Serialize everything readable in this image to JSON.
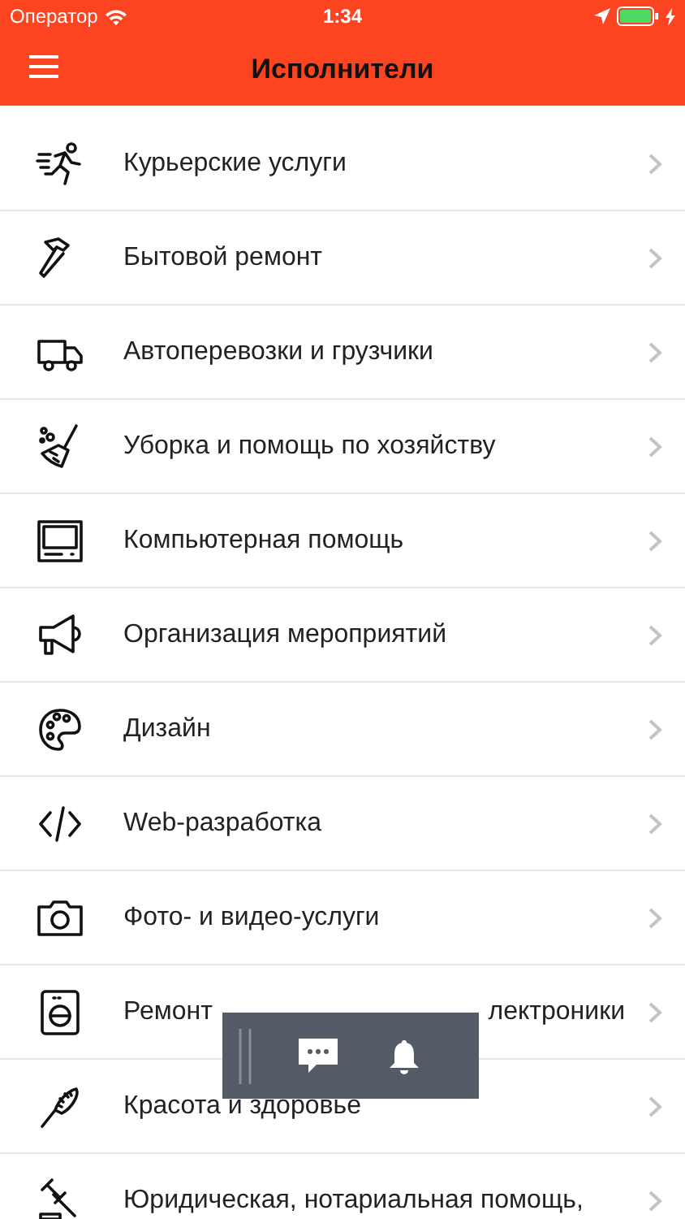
{
  "status_bar": {
    "carrier": "Оператор",
    "time": "1:34"
  },
  "nav_bar": {
    "title": "Исполнители"
  },
  "categories": [
    {
      "label": "Курьерские услуги"
    },
    {
      "label": "Бытовой ремонт"
    },
    {
      "label": "Автоперевозки и грузчики"
    },
    {
      "label": "Уборка и помощь по хозяйству"
    },
    {
      "label": "Компьютерная помощь"
    },
    {
      "label": "Организация мероприятий"
    },
    {
      "label": "Дизайн"
    },
    {
      "label": "Web-разработка"
    },
    {
      "label": "Фото- и видео-услуги"
    },
    {
      "label": "Ремонт",
      "label_tail": "лектроники"
    },
    {
      "label": "Красота и здоровье"
    },
    {
      "label": "Юридическая, нотариальная помощь,"
    }
  ]
}
